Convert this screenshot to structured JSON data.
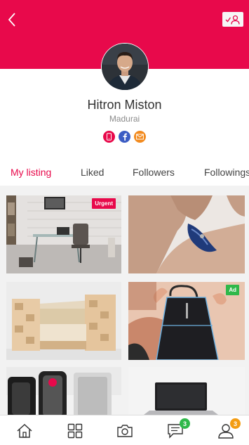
{
  "colors": {
    "accent": "#e8094b",
    "phone": "#e8094b",
    "facebook": "#3b5cc4",
    "email": "#f28a1e",
    "urgent_badge": "#e8094b",
    "ad_badge": "#2fb84a",
    "chat_badge": "#2fb84a",
    "profile_badge": "#f39c12"
  },
  "header": {
    "back_icon": "chevron-left-icon",
    "follow_icon": "user-check-icon"
  },
  "profile": {
    "name": "Hitron Miston",
    "location": "Madurai",
    "contacts": [
      {
        "icon": "phone-icon"
      },
      {
        "icon": "facebook-icon"
      },
      {
        "icon": "email-icon"
      }
    ]
  },
  "tabs": [
    {
      "label": "My listing",
      "active": true
    },
    {
      "label": "Liked",
      "active": false
    },
    {
      "label": "Followers",
      "active": false
    },
    {
      "label": "Followings",
      "active": false
    }
  ],
  "listings": [
    {
      "image": "office-interior",
      "badge": "Urgent"
    },
    {
      "image": "wrist-bracelet",
      "badge": ""
    },
    {
      "image": "wooden-armchair",
      "badge": ""
    },
    {
      "image": "black-backpack",
      "badge": "Ad"
    },
    {
      "image": "kettle-appliance",
      "badge": ""
    },
    {
      "image": "laptop-desk",
      "badge": ""
    }
  ],
  "bottom_nav": [
    {
      "icon": "home-icon",
      "badge": ""
    },
    {
      "icon": "grid-icon",
      "badge": ""
    },
    {
      "icon": "camera-icon",
      "badge": ""
    },
    {
      "icon": "chat-icon",
      "badge": "3"
    },
    {
      "icon": "profile-icon",
      "badge": "3"
    }
  ]
}
